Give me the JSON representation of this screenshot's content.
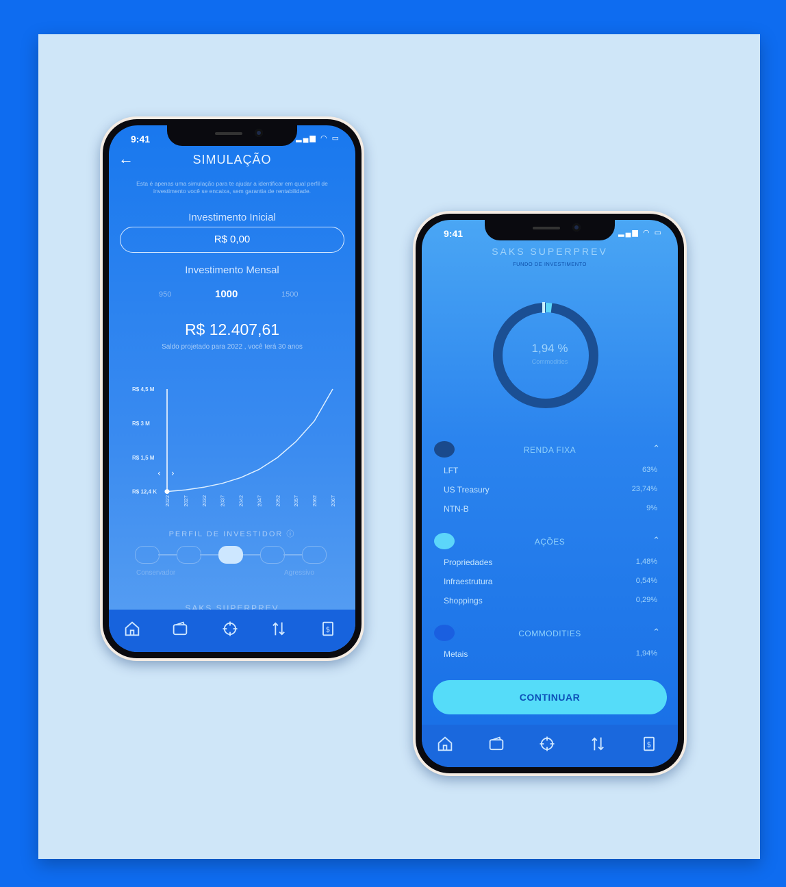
{
  "phone1": {
    "status_time": "9:41",
    "title": "SIMULAÇÃO",
    "disclaimer": "Esta é apenas uma simulação para te ajudar a identificar em qual perfil de investimento você se encaixa, sem garantia de rentabilidade.",
    "initial_label": "Investimento Inicial",
    "initial_value": "R$ 0,00",
    "monthly_label": "Investimento Mensal",
    "picker": {
      "prev": "950",
      "selected": "1000",
      "next": "1500"
    },
    "projected_value": "R$ 12.407,61",
    "projected_caption": "Saldo projetado para 2022 , você terá 30 anos",
    "perfil_label": "PERFIL DE INVESTIDOR",
    "perfil_left": "Conservador",
    "perfil_right": "Agressivo",
    "perfil_selected_index": 2,
    "footer_title": "SAKS SUPERPREV",
    "tabs": [
      "home-icon",
      "wallet-icon",
      "target-icon",
      "transfer-icon",
      "receipt-icon"
    ]
  },
  "chart_data": {
    "type": "line",
    "y_ticks": [
      "R$ 12,4 K",
      "R$ 1,5 M",
      "R$ 3 M",
      "R$ 4,5 M"
    ],
    "x_ticks": [
      "2022",
      "2027",
      "2032",
      "2037",
      "2042",
      "2047",
      "2052",
      "2057",
      "2062",
      "2067"
    ],
    "series": [
      {
        "values": [
          0.0124,
          0.08,
          0.2,
          0.37,
          0.62,
          0.98,
          1.5,
          2.2,
          3.1,
          4.5
        ]
      }
    ],
    "ylim": [
      0,
      4.5
    ]
  },
  "phone2": {
    "status_time": "9:41",
    "title": "SAKS SUPERPREV",
    "subtitle": "FUNDO DE INVESTIMENTO",
    "donut_value": "1,94 %",
    "donut_label": "Commodities",
    "donut_fraction": 0.0194,
    "sections": [
      {
        "title": "RENDA FIXA",
        "color": "#1a4a8c",
        "items": [
          {
            "name": "LFT",
            "value": "63%"
          },
          {
            "name": "US Treasury",
            "value": "23,74%"
          },
          {
            "name": "NTN-B",
            "value": "9%"
          }
        ]
      },
      {
        "title": "AÇÕES",
        "color": "#5cd6fa",
        "items": [
          {
            "name": "Propriedades",
            "value": "1,48%"
          },
          {
            "name": "Infraestrutura",
            "value": "0,54%"
          },
          {
            "name": "Shoppings",
            "value": "0,29%"
          }
        ]
      },
      {
        "title": "COMMODITIES",
        "color": "#1a5fe0",
        "items": [
          {
            "name": "Metais",
            "value": "1,94%"
          }
        ]
      }
    ],
    "cta": "CONTINUAR"
  }
}
